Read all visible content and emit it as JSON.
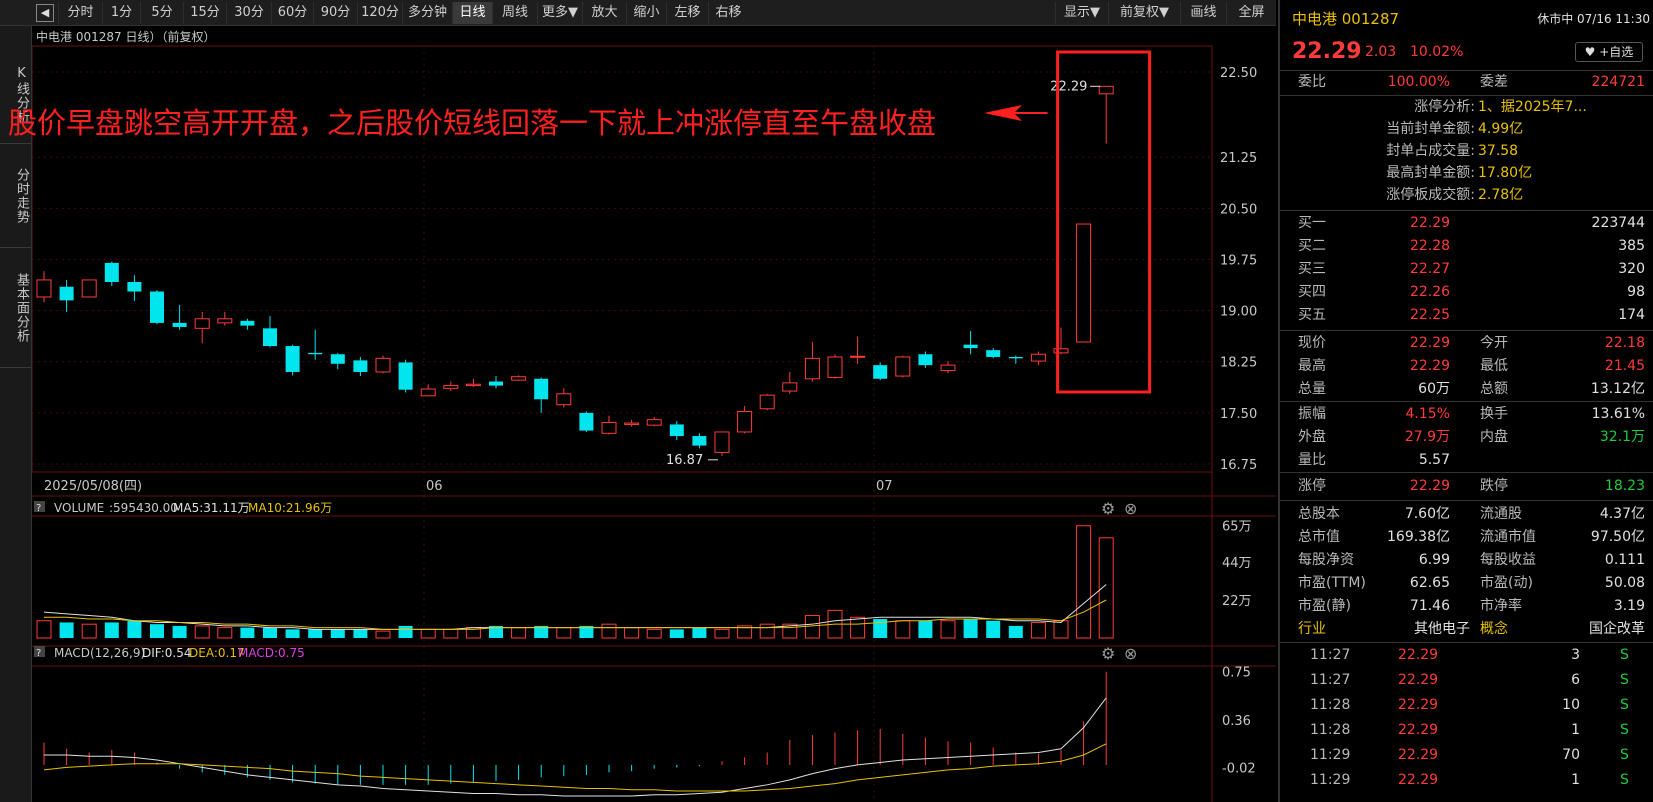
{
  "toolbar": {
    "collapse": "◀",
    "items": [
      "分时",
      "1分",
      "5分",
      "15分",
      "30分",
      "60分",
      "90分",
      "120分",
      "多分钟",
      "日线",
      "周线",
      "更多▼",
      "放大",
      "缩小",
      "左移",
      "右移"
    ],
    "active_index": 9,
    "right_items": [
      "显示▼",
      "前复权▼",
      "画线",
      "全屏"
    ]
  },
  "left_tabs": [
    "K线分析",
    "分时走势",
    "基本面分析"
  ],
  "chart": {
    "header": "中电港 001287 日线）（前复权）",
    "date_label": "2025/05/08(四)",
    "month_labels": [
      "06",
      "07"
    ],
    "price_ticks": [
      "22.50",
      "21.25",
      "20.50",
      "19.75",
      "19.00",
      "18.25",
      "17.50",
      "16.75"
    ],
    "high_label": "22.29",
    "low_label": "16.87",
    "annotation": "股价早盘跳空高开开盘，之后股价短线回落一下就上冲涨停直至午盘收盘",
    "volume_header": {
      "q": "?",
      "label": "VOLUME",
      "value": ":595430.00",
      "ma5": "MA5:31.11万",
      "ma10": "MA10:21.96万"
    },
    "volume_ticks": [
      "65万",
      "44万",
      "22万"
    ],
    "macd_header": {
      "q": "?",
      "label": "MACD(12,26,9)",
      "dif": "DIF:0.54",
      "dea": "DEA:0.17",
      "macd": "MACD:0.75"
    },
    "macd_ticks": [
      "0.75",
      "0.36",
      "-0.02"
    ]
  },
  "chart_data": {
    "type": "candlestick",
    "colors": {
      "up": "#ff3b3b",
      "down": "#00e5ee",
      "ma5": "#e0e0e0",
      "ma10": "#e8c000",
      "highlight": "#ff2020"
    },
    "ylim": [
      16.75,
      22.5
    ],
    "candles": [
      {
        "o": 19.2,
        "c": 19.45,
        "h": 19.58,
        "l": 19.12
      },
      {
        "o": 19.35,
        "c": 19.15,
        "h": 19.45,
        "l": 18.98
      },
      {
        "o": 19.2,
        "c": 19.45,
        "h": 19.45,
        "l": 19.2
      },
      {
        "o": 19.7,
        "c": 19.42,
        "h": 19.72,
        "l": 19.36
      },
      {
        "o": 19.42,
        "c": 19.28,
        "h": 19.52,
        "l": 19.14
      },
      {
        "o": 19.28,
        "c": 18.82,
        "h": 19.3,
        "l": 18.8
      },
      {
        "o": 18.82,
        "c": 18.76,
        "h": 19.08,
        "l": 18.72
      },
      {
        "o": 18.74,
        "c": 18.88,
        "h": 18.98,
        "l": 18.52
      },
      {
        "o": 18.82,
        "c": 18.88,
        "h": 18.98,
        "l": 18.78
      },
      {
        "o": 18.85,
        "c": 18.78,
        "h": 18.88,
        "l": 18.72
      },
      {
        "o": 18.74,
        "c": 18.48,
        "h": 18.92,
        "l": 18.46
      },
      {
        "o": 18.48,
        "c": 18.1,
        "h": 18.5,
        "l": 18.05
      },
      {
        "o": 18.38,
        "c": 18.36,
        "h": 18.72,
        "l": 18.28
      },
      {
        "o": 18.36,
        "c": 18.22,
        "h": 18.38,
        "l": 18.14
      },
      {
        "o": 18.27,
        "c": 18.1,
        "h": 18.32,
        "l": 18.04
      },
      {
        "o": 18.1,
        "c": 18.3,
        "h": 18.34,
        "l": 18.08
      },
      {
        "o": 18.24,
        "c": 17.84,
        "h": 18.28,
        "l": 17.8
      },
      {
        "o": 17.75,
        "c": 17.85,
        "h": 17.92,
        "l": 17.75
      },
      {
        "o": 17.86,
        "c": 17.9,
        "h": 17.96,
        "l": 17.82
      },
      {
        "o": 17.9,
        "c": 17.92,
        "h": 18.0,
        "l": 17.88
      },
      {
        "o": 17.96,
        "c": 17.9,
        "h": 18.04,
        "l": 17.86
      },
      {
        "o": 17.98,
        "c": 18.03,
        "h": 18.05,
        "l": 17.97
      },
      {
        "o": 18.0,
        "c": 17.7,
        "h": 18.02,
        "l": 17.5
      },
      {
        "o": 17.62,
        "c": 17.78,
        "h": 17.86,
        "l": 17.58
      },
      {
        "o": 17.5,
        "c": 17.24,
        "h": 17.52,
        "l": 17.22
      },
      {
        "o": 17.2,
        "c": 17.36,
        "h": 17.46,
        "l": 17.18
      },
      {
        "o": 17.33,
        "c": 17.35,
        "h": 17.4,
        "l": 17.3
      },
      {
        "o": 17.32,
        "c": 17.4,
        "h": 17.44,
        "l": 17.3
      },
      {
        "o": 17.33,
        "c": 17.16,
        "h": 17.38,
        "l": 17.1
      },
      {
        "o": 17.16,
        "c": 17.02,
        "h": 17.2,
        "l": 16.98
      },
      {
        "o": 16.92,
        "c": 17.22,
        "h": 17.22,
        "l": 16.87
      },
      {
        "o": 17.22,
        "c": 17.52,
        "h": 17.6,
        "l": 17.2
      },
      {
        "o": 17.56,
        "c": 17.76,
        "h": 17.78,
        "l": 17.54
      },
      {
        "o": 17.82,
        "c": 17.94,
        "h": 18.1,
        "l": 17.78
      },
      {
        "o": 18.0,
        "c": 18.3,
        "h": 18.54,
        "l": 17.96
      },
      {
        "o": 18.02,
        "c": 18.32,
        "h": 18.36,
        "l": 18.0
      },
      {
        "o": 18.32,
        "c": 18.33,
        "h": 18.62,
        "l": 18.22
      },
      {
        "o": 18.2,
        "c": 18.0,
        "h": 18.24,
        "l": 17.98
      },
      {
        "o": 18.04,
        "c": 18.32,
        "h": 18.34,
        "l": 18.02
      },
      {
        "o": 18.36,
        "c": 18.2,
        "h": 18.4,
        "l": 18.16
      },
      {
        "o": 18.12,
        "c": 18.2,
        "h": 18.26,
        "l": 18.08
      },
      {
        "o": 18.5,
        "c": 18.45,
        "h": 18.7,
        "l": 18.36
      },
      {
        "o": 18.42,
        "c": 18.32,
        "h": 18.45,
        "l": 18.3
      },
      {
        "o": 18.32,
        "c": 18.3,
        "h": 18.34,
        "l": 18.22
      },
      {
        "o": 18.26,
        "c": 18.36,
        "h": 18.4,
        "l": 18.2
      },
      {
        "o": 18.38,
        "c": 18.44,
        "h": 18.75,
        "l": 18.36
      },
      {
        "o": 18.54,
        "c": 20.27,
        "h": 20.27,
        "l": 18.54
      },
      {
        "o": 22.18,
        "c": 22.29,
        "h": 22.29,
        "l": 21.45
      }
    ],
    "volume": {
      "ylim": [
        0,
        66
      ],
      "values": [
        10,
        9,
        8,
        9,
        10,
        8,
        7,
        7,
        6,
        6,
        6,
        5,
        5,
        5,
        5,
        4,
        7,
        5,
        5,
        6,
        7,
        6,
        7,
        6,
        7,
        8,
        6,
        5,
        5,
        6,
        5,
        7,
        8,
        8,
        13,
        16,
        12,
        11,
        10,
        10,
        10,
        11,
        10,
        7,
        9,
        10,
        65,
        58
      ],
      "ma5": [
        15,
        14,
        13,
        12,
        10,
        9,
        9,
        8,
        7,
        7,
        6,
        6,
        5,
        5,
        5,
        5,
        5,
        5,
        5,
        6,
        6,
        6,
        6,
        6,
        6,
        6,
        6,
        6,
        6,
        6,
        6,
        6,
        6,
        7,
        8,
        10,
        11,
        12,
        12,
        12,
        12,
        12,
        11,
        10,
        10,
        9,
        20,
        31
      ],
      "ma10": [
        12,
        12,
        11,
        11,
        10,
        10,
        9,
        9,
        8,
        8,
        7,
        7,
        6,
        6,
        6,
        5,
        5,
        5,
        5,
        5,
        6,
        6,
        6,
        6,
        6,
        6,
        6,
        6,
        6,
        6,
        6,
        6,
        6,
        6,
        7,
        8,
        8,
        9,
        10,
        10,
        11,
        11,
        11,
        11,
        11,
        10,
        15,
        22
      ]
    },
    "macd": {
      "ylim": [
        -0.25,
        0.78
      ],
      "hist": [
        0.18,
        0.13,
        0.1,
        0.12,
        0.1,
        0.02,
        -0.03,
        -0.06,
        -0.08,
        -0.1,
        -0.12,
        -0.14,
        -0.15,
        -0.16,
        -0.16,
        -0.16,
        -0.16,
        -0.16,
        -0.15,
        -0.14,
        -0.13,
        -0.12,
        -0.1,
        -0.09,
        -0.08,
        -0.06,
        -0.05,
        -0.03,
        -0.02,
        -0.01,
        0.03,
        0.06,
        0.1,
        0.2,
        0.24,
        0.26,
        0.28,
        0.29,
        0.25,
        0.22,
        0.19,
        0.18,
        0.14,
        0.1,
        0.09,
        0.12,
        0.35,
        0.75
      ],
      "dif": [
        0.08,
        0.08,
        0.07,
        0.07,
        0.06,
        0.04,
        0.01,
        -0.02,
        -0.05,
        -0.08,
        -0.1,
        -0.12,
        -0.14,
        -0.16,
        -0.17,
        -0.19,
        -0.2,
        -0.21,
        -0.22,
        -0.23,
        -0.23,
        -0.24,
        -0.24,
        -0.25,
        -0.25,
        -0.25,
        -0.25,
        -0.24,
        -0.24,
        -0.23,
        -0.22,
        -0.19,
        -0.16,
        -0.12,
        -0.07,
        -0.03,
        0.0,
        0.02,
        0.04,
        0.05,
        0.06,
        0.07,
        0.08,
        0.09,
        0.1,
        0.13,
        0.3,
        0.54
      ],
      "dea": [
        -0.04,
        -0.02,
        -0.01,
        0.0,
        0.01,
        0.01,
        0.01,
        0.0,
        -0.01,
        -0.02,
        -0.03,
        -0.05,
        -0.06,
        -0.07,
        -0.09,
        -0.1,
        -0.11,
        -0.12,
        -0.13,
        -0.14,
        -0.15,
        -0.16,
        -0.17,
        -0.18,
        -0.19,
        -0.19,
        -0.2,
        -0.2,
        -0.21,
        -0.21,
        -0.21,
        -0.21,
        -0.2,
        -0.19,
        -0.17,
        -0.15,
        -0.12,
        -0.1,
        -0.08,
        -0.06,
        -0.04,
        -0.03,
        -0.01,
        0.0,
        0.01,
        0.03,
        0.08,
        0.17
      ]
    }
  },
  "rp": {
    "name": "中电港 001287",
    "status": "休市中 07/16 11:30",
    "price": "22.29",
    "change": "2.03",
    "pct": "10.02%",
    "fav": "♥ +自选",
    "weibi_label": "委比",
    "weibi": "100.00%",
    "weicha_label": "委差",
    "weicha": "224721",
    "zt_items": [
      {
        "k": "涨停分析:",
        "v": "1、据2025年7..."
      },
      {
        "k": "当前封单金额:",
        "v": "4.99亿"
      },
      {
        "k": "封单占成交量:",
        "v": "37.58"
      },
      {
        "k": "最高封单金额:",
        "v": "17.80亿"
      },
      {
        "k": "涨停板成交额:",
        "v": "2.78亿"
      }
    ],
    "buys": [
      {
        "k": "买一",
        "p": "22.29",
        "v": "223744"
      },
      {
        "k": "买二",
        "p": "22.28",
        "v": "385"
      },
      {
        "k": "买三",
        "p": "22.27",
        "v": "320"
      },
      {
        "k": "买四",
        "p": "22.26",
        "v": "98"
      },
      {
        "k": "买五",
        "p": "22.25",
        "v": "174"
      }
    ],
    "q1": [
      {
        "a": "现价",
        "av": "22.29",
        "ac": "red",
        "b": "今开",
        "bv": "22.18",
        "bc": "red"
      },
      {
        "a": "最高",
        "av": "22.29",
        "ac": "red",
        "b": "最低",
        "bv": "21.45",
        "bc": "red"
      },
      {
        "a": "总量",
        "av": "60万",
        "ac": "white",
        "b": "总额",
        "bv": "13.12亿",
        "bc": "white"
      }
    ],
    "q2": [
      {
        "a": "振幅",
        "av": "4.15%",
        "ac": "red",
        "b": "换手",
        "bv": "13.61%",
        "bc": "white"
      },
      {
        "a": "外盘",
        "av": "27.9万",
        "ac": "red",
        "b": "内盘",
        "bv": "32.1万",
        "bc": "green"
      },
      {
        "a": "量比",
        "av": "5.57",
        "ac": "white",
        "b": "",
        "bv": "",
        "bc": "white"
      }
    ],
    "q3": [
      {
        "a": "涨停",
        "av": "22.29",
        "ac": "red",
        "b": "跌停",
        "bv": "18.23",
        "bc": "green"
      }
    ],
    "q4": [
      {
        "a": "总股本",
        "av": "7.60亿",
        "ac": "white",
        "b": "流通股",
        "bv": "4.37亿",
        "bc": "white"
      },
      {
        "a": "总市值",
        "av": "169.38亿",
        "ac": "white",
        "b": "流通市值",
        "bv": "97.50亿",
        "bc": "white"
      },
      {
        "a": "每股净资",
        "av": "6.99",
        "ac": "white",
        "b": "每股收益",
        "bv": "0.111",
        "bc": "white"
      },
      {
        "a": "市盈(TTM)",
        "av": "62.65",
        "ac": "white",
        "b": "市盈(动)",
        "bv": "50.08",
        "bc": "white"
      },
      {
        "a": "市盈(静)",
        "av": "71.46",
        "ac": "white",
        "b": "市净率",
        "bv": "3.19",
        "bc": "white"
      }
    ],
    "industry": {
      "k1": "行业",
      "v1": "其他电子",
      "k2": "概念",
      "v2": "国企改革"
    },
    "ticks": [
      {
        "t": "11:27",
        "p": "22.29",
        "v": "3",
        "s": "S"
      },
      {
        "t": "11:27",
        "p": "22.29",
        "v": "6",
        "s": "S"
      },
      {
        "t": "11:28",
        "p": "22.29",
        "v": "10",
        "s": "S"
      },
      {
        "t": "11:28",
        "p": "22.29",
        "v": "1",
        "s": "S"
      },
      {
        "t": "11:29",
        "p": "22.29",
        "v": "70",
        "s": "S"
      },
      {
        "t": "11:29",
        "p": "22.29",
        "v": "1",
        "s": "S"
      }
    ]
  }
}
